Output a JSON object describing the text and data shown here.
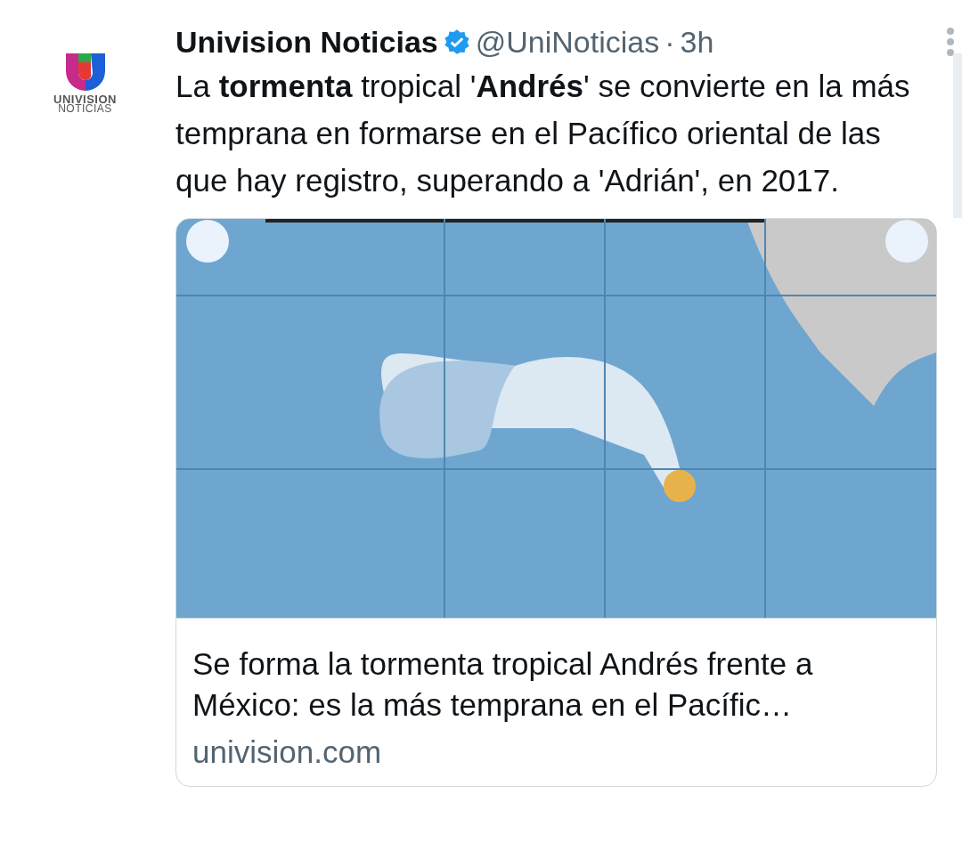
{
  "avatar": {
    "logo_lines": [
      "UNIVISION",
      "NOTICIAS"
    ]
  },
  "tweet": {
    "name": "Univision Noticias",
    "verified": true,
    "handle": "@UniNoticias",
    "separator": "·",
    "time": "3h",
    "text": "La **tormenta** tropical '**Andrés**' se convierte en la más temprana en formarse en el Pacífico oriental de las que hay registro, superando a 'Adrián', en 2017."
  },
  "card": {
    "title": "Se forma la tormenta tropical Andrés frente a México: es la más temprana en el Pacífic…",
    "domain": "univision.com"
  }
}
